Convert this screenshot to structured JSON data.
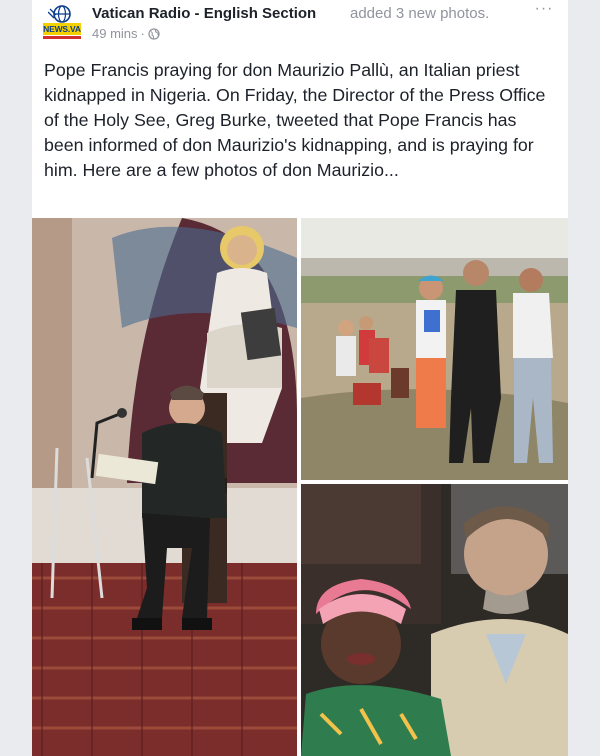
{
  "post": {
    "page_name": "Vatican Radio - English Section",
    "action": "added 3 new photos.",
    "time": "49 mins",
    "separator": "·",
    "privacy_icon": "globe-icon",
    "more_icon": "more-options-icon",
    "more_label": "···",
    "avatar": {
      "badge_text": "NEWS.VA"
    },
    "text": "Pope Francis praying for don Maurizio Pallù, an Italian priest kidnapped in Nigeria. On Friday, the Director of the Press Office of the Holy See, Greg Burke, tweeted that Pope Francis has been informed of don Maurizio's kidnapping, and is praying for him. Here are a few photos of don Maurizio..."
  },
  "photos": [
    {
      "name": "priest reading at microphone"
    },
    {
      "name": "group photo outdoors"
    },
    {
      "name": "priest with woman"
    }
  ],
  "colors": {
    "background": "#e9ebee",
    "card": "#ffffff",
    "text": "#1d2129",
    "secondary_text": "#90949c"
  }
}
